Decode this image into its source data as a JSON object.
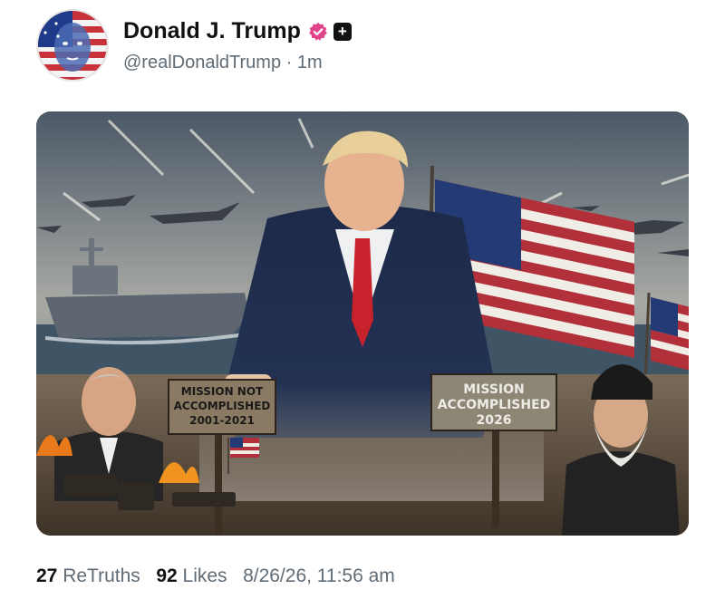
{
  "post": {
    "author": {
      "display_name": "Donald J. Trump",
      "handle": "@realDonaldTrump",
      "separator": "·",
      "time_ago": "1m",
      "avatar_icon": "american-flag-face-avatar",
      "verified_icon": "verified-badge-icon",
      "verified_color": "#e0458c",
      "plus_badge": "+"
    },
    "image": {
      "sign_left_lines": [
        "MISSION NOT",
        "ACCOMPLISHED",
        "2001-2021"
      ],
      "sign_right_lines": [
        "MISSION",
        "ACCOMPLISHED",
        "2026"
      ]
    },
    "stats": {
      "retruths_count": "27",
      "retruths_label": "ReTruths",
      "likes_count": "92",
      "likes_label": "Likes",
      "timestamp": "8/26/26, 11:56 am"
    }
  }
}
